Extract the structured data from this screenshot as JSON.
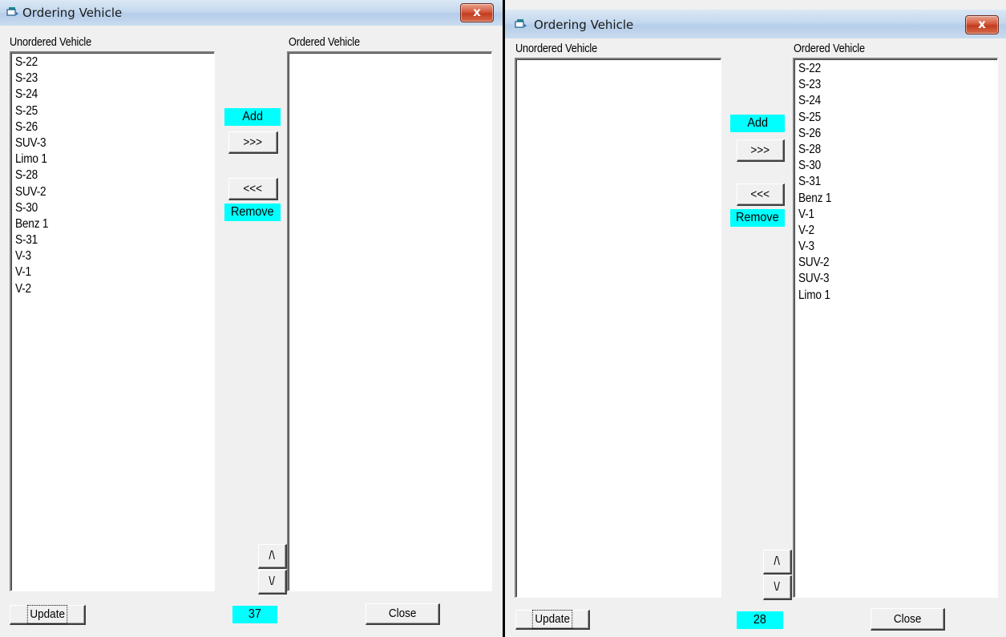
{
  "left_window": {
    "title": "Ordering Vehicle",
    "close_glyph": "x",
    "unordered_label": "Unordered Vehicle",
    "ordered_label": "Ordered Vehicle",
    "unordered_items": [
      "S-22",
      "S-23",
      "S-24",
      "S-25",
      "S-26",
      "SUV-3",
      "Limo 1",
      "S-28",
      "SUV-2",
      "S-30",
      "Benz 1",
      "S-31",
      "V-3",
      "V-1",
      "V-2"
    ],
    "ordered_items": [],
    "add_label": "Add",
    "add_button": ">>>",
    "remove_button": "<<<",
    "remove_label": "Remove",
    "move_up": "/\\",
    "move_down": "\\/",
    "update_button": "Update",
    "count": "37",
    "close_button": "Close"
  },
  "right_window": {
    "title": "Ordering Vehicle",
    "close_glyph": "x",
    "unordered_label": "Unordered Vehicle",
    "ordered_label": "Ordered Vehicle",
    "unordered_items": [],
    "ordered_items": [
      "S-22",
      "S-23",
      "S-24",
      "S-25",
      "S-26",
      "S-28",
      "S-30",
      "S-31",
      "Benz 1",
      "V-1",
      "V-2",
      "V-3",
      "SUV-2",
      "SUV-3",
      "Limo 1"
    ],
    "add_label": "Add",
    "add_button": ">>>",
    "remove_button": "<<<",
    "remove_label": "Remove",
    "move_up": "/\\",
    "move_down": "\\/",
    "update_button": "Update",
    "count": "28",
    "close_button": "Close"
  },
  "colors": {
    "highlight_cyan": "#00ffff",
    "close_red": "#c7452a",
    "titlebar": "#c4d8ee"
  },
  "icons": {
    "title_icon": "window-app-icon",
    "close_icon": "close-x-icon"
  }
}
